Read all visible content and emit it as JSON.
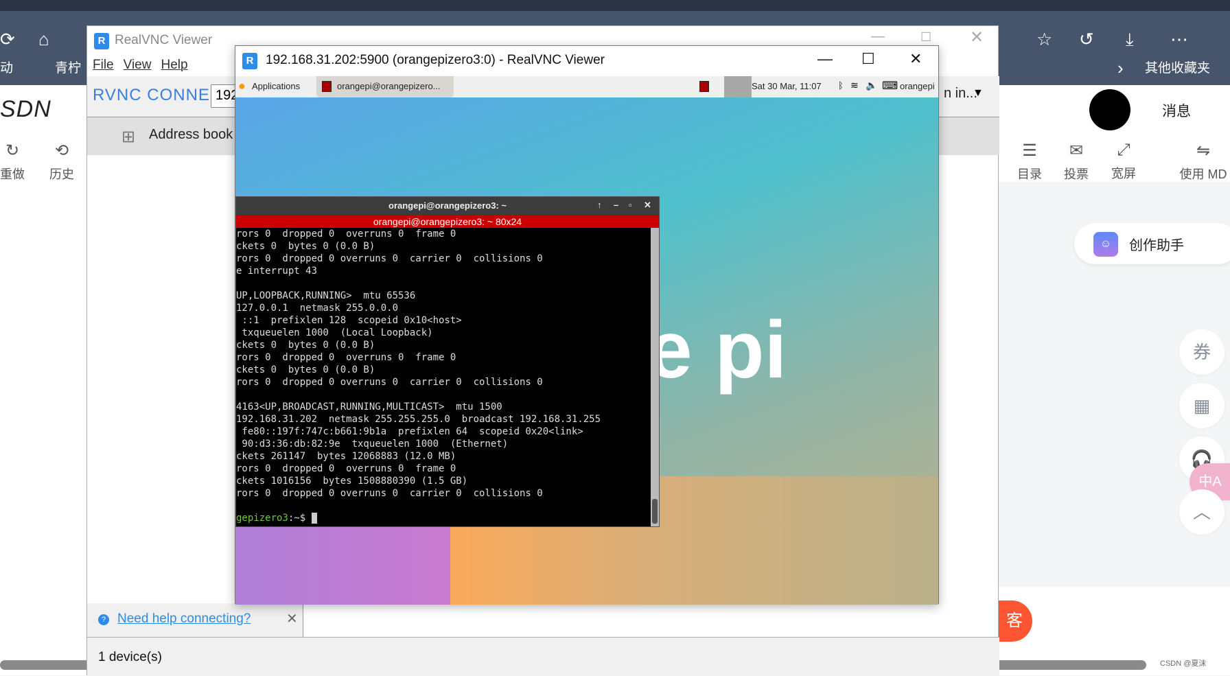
{
  "browser": {
    "bookmarks": [
      "动",
      "青柠",
      "其他收藏夹"
    ]
  },
  "csdn": {
    "logo": "SDN",
    "tools_left": [
      {
        "label": "重做",
        "icon": "redo-icon"
      },
      {
        "label": "历史",
        "icon": "history-icon"
      }
    ],
    "tools_right": [
      {
        "label": "目录",
        "icon": "toc-icon"
      },
      {
        "label": "投票",
        "icon": "vote-icon"
      },
      {
        "label": "宽屏",
        "icon": "widescreen-icon"
      },
      {
        "label": "使用 MD",
        "icon": "md-icon"
      }
    ],
    "messages": "消息",
    "assistant": "创作助手",
    "side_buttons": [
      "券",
      "QR",
      "headset",
      "中A",
      "top"
    ],
    "ke_button": "客",
    "watermark": "CSDN @夏沫"
  },
  "vnc_main": {
    "title": "RealVNC Viewer",
    "menu": [
      "File",
      "View",
      "Help"
    ],
    "brand": "RVNC CONNECT",
    "search_value": "192",
    "signin": "n in...",
    "address_book": "Address book",
    "help_link": "Need help connecting?",
    "device_count": "1 device(s)"
  },
  "vnc_session": {
    "title": "192.168.31.202:5900 (orangepizero3:0) - RealVNC Viewer",
    "panel": {
      "applications": "Applications",
      "task": "orangepi@orangepizero...",
      "clock": "Sat 30 Mar, 11:07",
      "user": "orangepi"
    },
    "desktop_logo": "e pi",
    "terminal": {
      "title": "orangepi@orangepizero3: ~",
      "size_banner": "orangepi@orangepizero3: ~ 80x24",
      "lines": [
        "rors 0  dropped 0  overruns 0  frame 0",
        "ckets 0  bytes 0 (0.0 B)",
        "rors 0  dropped 0 overruns 0  carrier 0  collisions 0",
        "e interrupt 43",
        "",
        "UP,LOOPBACK,RUNNING>  mtu 65536",
        "127.0.0.1  netmask 255.0.0.0",
        " ::1  prefixlen 128  scopeid 0x10<host>",
        " txqueuelen 1000  (Local Loopback)",
        "ckets 0  bytes 0 (0.0 B)",
        "rors 0  dropped 0  overruns 0  frame 0",
        "ckets 0  bytes 0 (0.0 B)",
        "rors 0  dropped 0 overruns 0  carrier 0  collisions 0",
        "",
        "4163<UP,BROADCAST,RUNNING,MULTICAST>  mtu 1500",
        "192.168.31.202  netmask 255.255.255.0  broadcast 192.168.31.255",
        " fe80::197f:747c:b661:9b1a  prefixlen 64  scopeid 0x20<link>",
        " 90:d3:36:db:82:9e  txqueuelen 1000  (Ethernet)",
        "ckets 261147  bytes 12068883 (12.0 MB)",
        "rors 0  dropped 0  overruns 0  frame 0",
        "ckets 1016156  bytes 1508880390 (1.5 GB)",
        "rors 0  dropped 0 overruns 0  carrier 0  collisions 0",
        ""
      ],
      "prompt_host": "gepizero3",
      "prompt_path": ":~$"
    }
  }
}
